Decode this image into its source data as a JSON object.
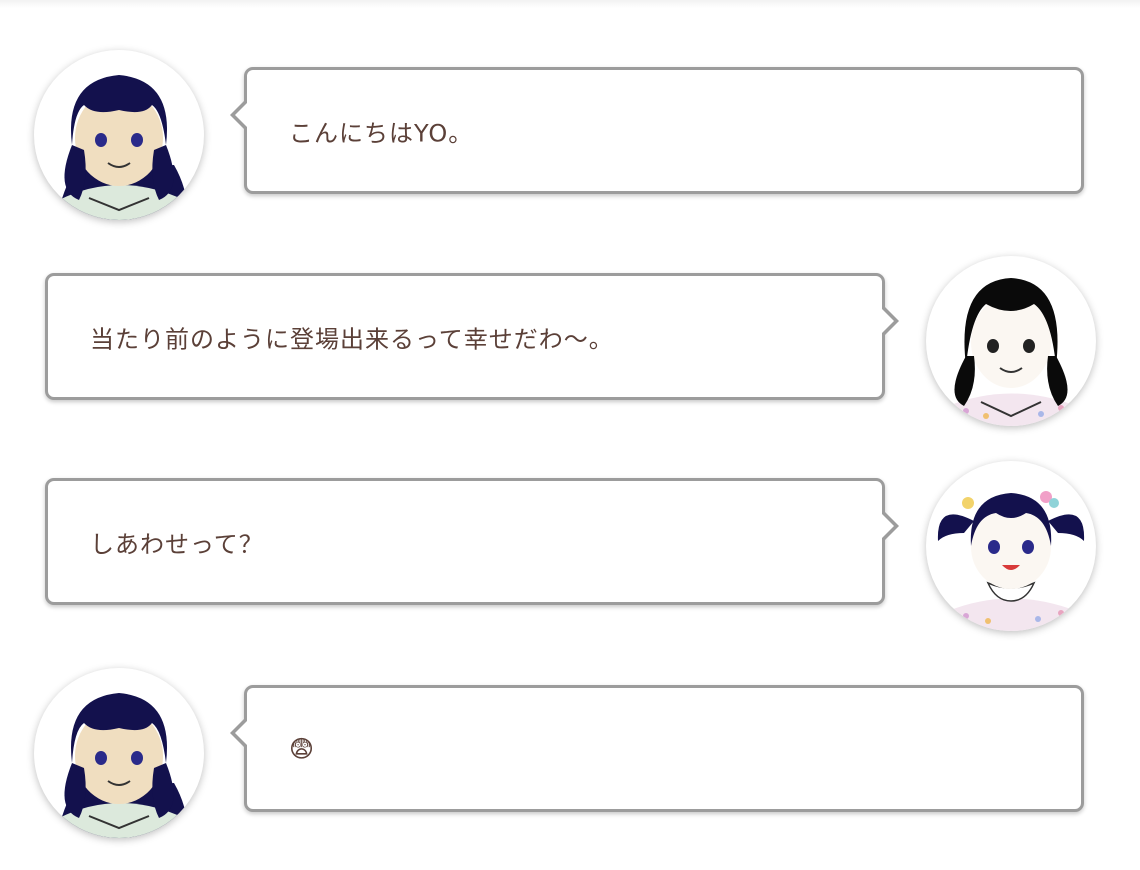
{
  "conversation": {
    "messages": [
      {
        "speaker": "navy-hair-girl",
        "side": "left",
        "text": "こんにちはYO。"
      },
      {
        "speaker": "black-hair-girl",
        "side": "right",
        "text": "当たり前のように登場出来るって幸せだわ〜。"
      },
      {
        "speaker": "pigtails-girl",
        "side": "right",
        "text": "しあわせって？"
      },
      {
        "speaker": "navy-hair-girl",
        "side": "left",
        "text": "😨"
      }
    ]
  },
  "colors": {
    "bubble_border": "#9c9c9c",
    "text": "#5b4038",
    "navy_hair": "#13114d",
    "black_hair": "#0a0a0a",
    "skin_tan": "#f0dec0",
    "skin_pale": "#fbf7f2"
  }
}
